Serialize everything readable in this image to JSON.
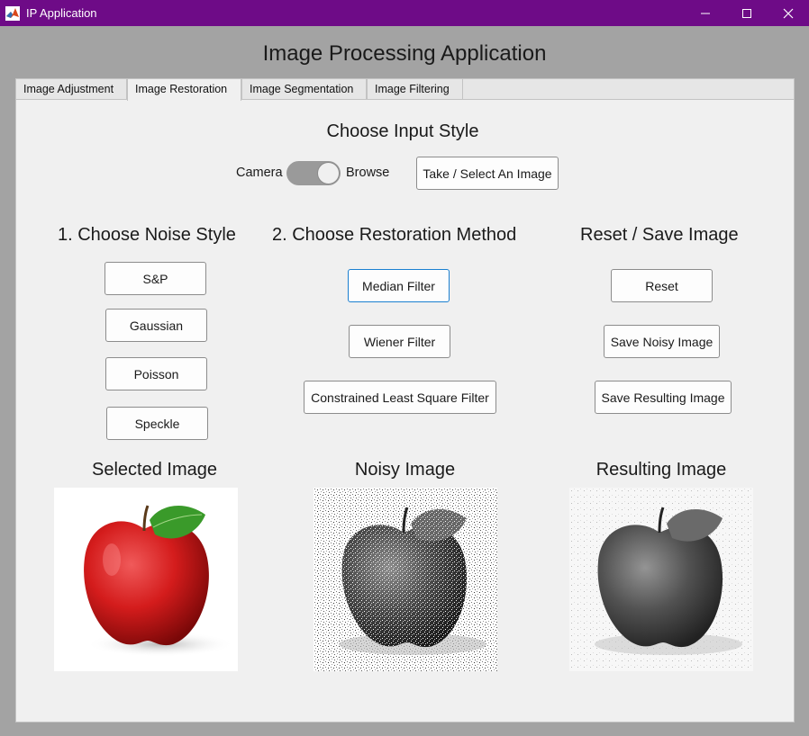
{
  "window": {
    "title": "IP Application",
    "controls": {
      "minimize": "minimize-icon",
      "maximize": "maximize-icon",
      "close": "close-icon"
    },
    "titlebar_color": "#6e0b87"
  },
  "app_title": "Image Processing Application",
  "tabs": [
    {
      "label": "Image Adjustment",
      "active": false
    },
    {
      "label": "Image Restoration",
      "active": true
    },
    {
      "label": "Image Segmentation",
      "active": false
    },
    {
      "label": "Image Filtering",
      "active": false
    }
  ],
  "input_style": {
    "heading": "Choose Input Style",
    "left_label": "Camera",
    "right_label": "Browse",
    "toggle_state": "Browse",
    "select_button": "Take / Select An Image"
  },
  "noise": {
    "heading": "1. Choose Noise Style",
    "buttons": [
      "S&P",
      "Gaussian",
      "Poisson",
      "Speckle"
    ]
  },
  "restoration": {
    "heading": "2. Choose Restoration Method",
    "buttons": [
      "Median Filter",
      "Wiener Filter",
      "Constrained Least Square Filter"
    ],
    "focused": "Median Filter"
  },
  "reset_save": {
    "heading": "Reset / Save Image",
    "buttons": [
      "Reset",
      "Save Noisy Image",
      "Save Resulting Image"
    ]
  },
  "images": {
    "selected": "Selected Image",
    "noisy": "Noisy Image",
    "result": "Resulting Image"
  }
}
